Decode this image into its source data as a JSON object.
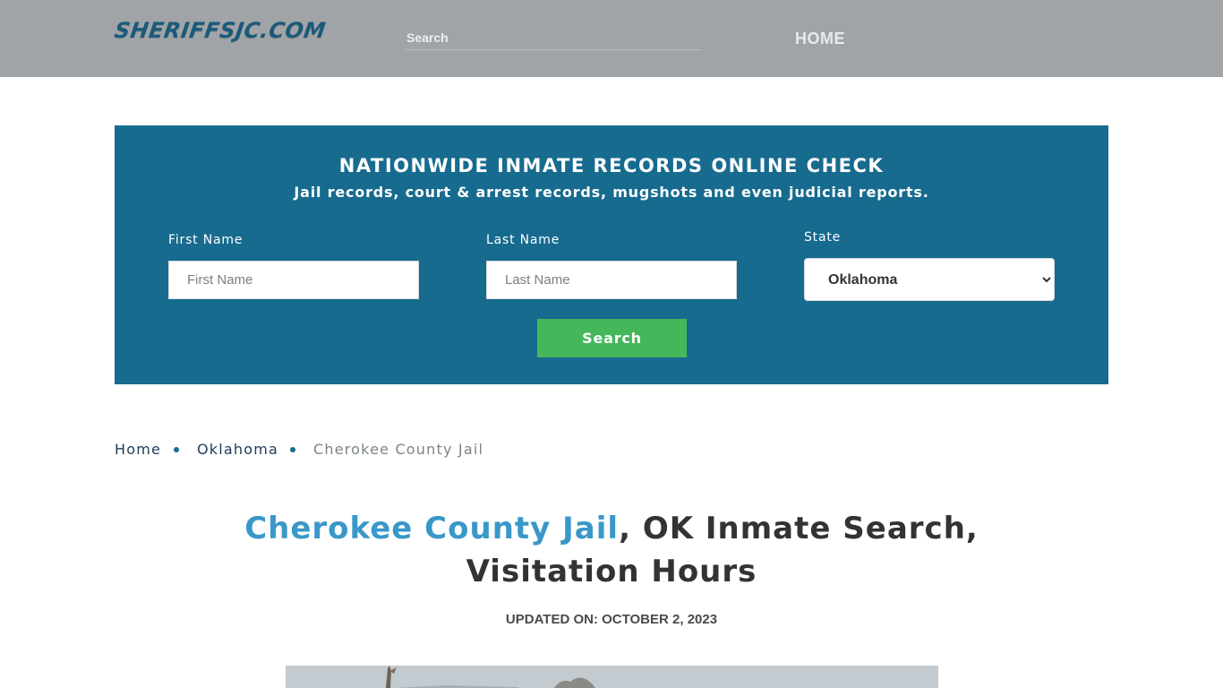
{
  "header": {
    "logo_text": "SHERIFFSJC.COM",
    "search_placeholder": "Search",
    "nav_home": "HOME"
  },
  "hero": {
    "title": "NATIONWIDE INMATE RECORDS ONLINE CHECK",
    "subtitle": "Jail records, court & arrest records, mugshots and even judicial reports.",
    "first_name_label": "First Name",
    "first_name_placeholder": "First Name",
    "last_name_label": "Last Name",
    "last_name_placeholder": "Last Name",
    "state_label": "State",
    "state_value": "Oklahoma",
    "search_button": "Search"
  },
  "breadcrumb": {
    "items": [
      "Home",
      "Oklahoma",
      "Cherokee County Jail"
    ]
  },
  "article": {
    "title_highlight": "Cherokee County Jail",
    "title_rest": ", OK Inmate Search, Visitation Hours",
    "updated": "UPDATED ON: OCTOBER 2, 2023"
  },
  "colors": {
    "topbar": "#a0a4a7",
    "hero": "#176b8f",
    "button": "#45b75a",
    "title_highlight": "#3a98c9"
  }
}
